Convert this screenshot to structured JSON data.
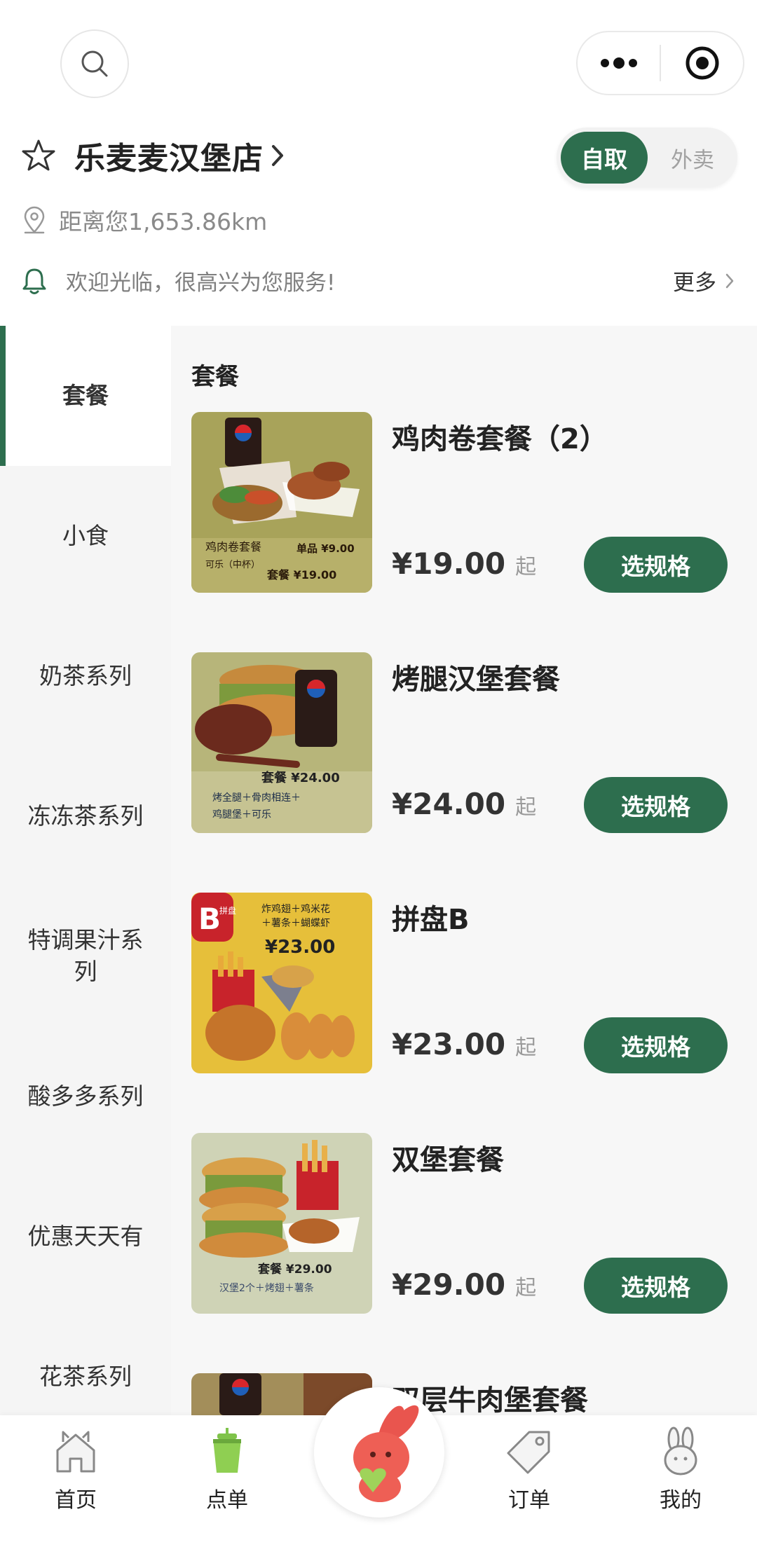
{
  "header": {
    "store_name": "乐麦麦汉堡店",
    "distance": "距离您1,653.86km",
    "notice": "欢迎光临，很高兴为您服务!",
    "more_label": "更多",
    "mode_toggle": {
      "active": "自取",
      "inactive": "外卖"
    }
  },
  "sidebar": {
    "items": [
      {
        "label": "套餐"
      },
      {
        "label": "小食"
      },
      {
        "label": "奶茶系列"
      },
      {
        "label": "冻冻茶系列"
      },
      {
        "label": "特调果汁系列"
      },
      {
        "label": "酸多多系列"
      },
      {
        "label": "优惠天天有"
      },
      {
        "label": "花茶系列"
      }
    ]
  },
  "main": {
    "section_title": "套餐",
    "items": [
      {
        "name": "鸡肉卷套餐（2）",
        "price": "¥19.00",
        "suffix": "起",
        "button": "选规格",
        "image_text": {
          "title": "鸡肉卷套餐",
          "sub": "可乐（中杯）",
          "single": "单品 ¥9.00",
          "combo": "套餐 ¥19.00"
        }
      },
      {
        "name": "烤腿汉堡套餐",
        "price": "¥24.00",
        "suffix": "起",
        "button": "选规格",
        "image_text": {
          "combo": "套餐 ¥24.00",
          "desc1": "烤全腿＋骨肉相连＋",
          "desc2": "鸡腿堡＋可乐"
        }
      },
      {
        "name": "拼盘B",
        "price": "¥23.00",
        "suffix": "起",
        "button": "选规格",
        "image_text": {
          "badge": "B",
          "badge_side": "拼盘",
          "desc1": "炸鸡翅＋鸡米花",
          "desc2": "＋薯条＋蝴蝶虾",
          "price": "¥23.00"
        }
      },
      {
        "name": "双堡套餐",
        "price": "¥29.00",
        "suffix": "起",
        "button": "选规格",
        "image_text": {
          "combo": "套餐 ¥29.00",
          "desc1": "汉堡2个＋烤翅＋薯条"
        }
      },
      {
        "name": "双层牛肉堡套餐"
      }
    ]
  },
  "bottom_nav": {
    "items": [
      {
        "label": "首页"
      },
      {
        "label": "点单"
      },
      {
        "label": "订单"
      },
      {
        "label": "我的"
      }
    ]
  },
  "colors": {
    "accent": "#2d6e4e",
    "sidebar_bg": "#f5f5f5",
    "content_bg": "#f7f7f7"
  }
}
